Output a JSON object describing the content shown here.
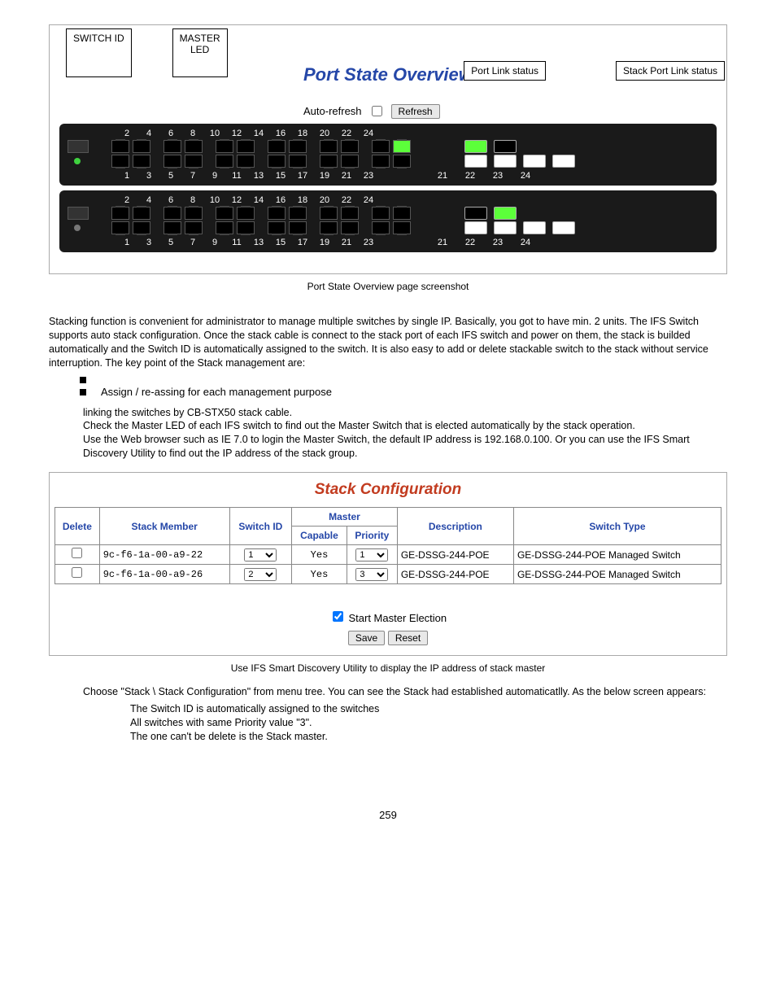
{
  "callouts": {
    "switch_id": "SWITCH ID",
    "master_led": "MASTER\nLED",
    "port_link": "Port Link status",
    "stack_link": "Stack Port Link status"
  },
  "fig1": {
    "title": "Port State Overview",
    "autorefresh": "Auto-refresh",
    "refresh_btn": "Refresh",
    "top_nums": [
      "2",
      "4",
      "6",
      "8",
      "10",
      "12",
      "14",
      "16",
      "18",
      "20",
      "22",
      "24"
    ],
    "bot_nums": [
      "1",
      "3",
      "5",
      "7",
      "9",
      "11",
      "13",
      "15",
      "17",
      "19",
      "21",
      "23"
    ],
    "stack_nums": [
      "21",
      "22",
      "23",
      "24"
    ]
  },
  "caption1": "Port State Overview page screenshot",
  "para1": "Stacking function is convenient for administrator to manage multiple switches by single IP. Basically, you got to have min. 2 units. The IFS Switch supports auto stack configuration. Once the stack cable is connect to the stack port of each IFS switch and power on them, the stack is builded automatically and the Switch ID is automatically assigned to the switch. It is also easy to add or delete stackable switch to the stack without service interruption. The key point of the Stack management are:",
  "bul2": "Assign / re-assing                       for each management purpose",
  "steps": {
    "s1": "linking the switches by CB-STX50 stack cable.",
    "s2": "Check the Master LED of each IFS switch to find out the Master Switch that is elected automatically by the stack operation.",
    "s3": "Use the Web browser such as IE 7.0 to login the Master Switch, the default IP address is 192.168.0.100. Or you can use the IFS Smart Discovery Utility to find out the IP address of the stack group."
  },
  "sc": {
    "title": "Stack Configuration",
    "headers": {
      "delete": "Delete",
      "member": "Stack Member",
      "sid": "Switch ID",
      "master": "Master",
      "capable": "Capable",
      "priority": "Priority",
      "desc": "Description",
      "type": "Switch Type"
    },
    "rows": [
      {
        "mac": "9c-f6-1a-00-a9-22",
        "sid": "1",
        "capable": "Yes",
        "priority": "1",
        "desc": "GE-DSSG-244-POE",
        "type": "GE-DSSG-244-POE Managed Switch"
      },
      {
        "mac": "9c-f6-1a-00-a9-26",
        "sid": "2",
        "capable": "Yes",
        "priority": "3",
        "desc": "GE-DSSG-244-POE",
        "type": "GE-DSSG-244-POE Managed Switch"
      }
    ],
    "sme": "Start Master Election",
    "save": "Save",
    "reset": "Reset"
  },
  "caption2": "Use IFS Smart Discovery Utility to display the IP address of stack master",
  "para2": "Choose \"Stack \\ Stack Configuration\" from menu tree. You can see the Stack had established automaticatlly. As the below screen appears:",
  "subs": {
    "a": "The Switch ID is automatically assigned to the switches",
    "b": "All switches with same Priority value \"3\".",
    "c": "The one can't be delete is the Stack master."
  },
  "page": "259"
}
